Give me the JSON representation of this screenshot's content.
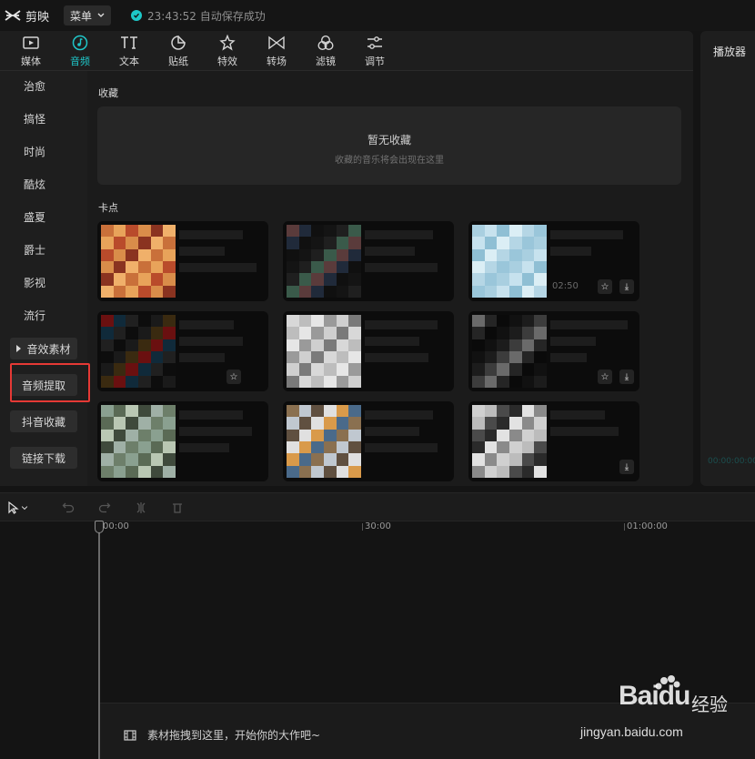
{
  "titlebar": {
    "app_name": "剪映",
    "menu_label": "菜单",
    "save_status": "23:43:52 自动保存成功"
  },
  "toolbar": {
    "tabs": [
      {
        "label": "媒体",
        "icon": "media-icon",
        "active": false
      },
      {
        "label": "音频",
        "icon": "audio-icon",
        "active": true
      },
      {
        "label": "文本",
        "icon": "text-icon",
        "active": false
      },
      {
        "label": "贴纸",
        "icon": "sticker-icon",
        "active": false
      },
      {
        "label": "特效",
        "icon": "effects-icon",
        "active": false
      },
      {
        "label": "转场",
        "icon": "transition-icon",
        "active": false
      },
      {
        "label": "滤镜",
        "icon": "filter-icon",
        "active": false
      },
      {
        "label": "调节",
        "icon": "adjust-icon",
        "active": false
      }
    ]
  },
  "sidebar": {
    "categories": [
      "治愈",
      "搞怪",
      "时尚",
      "酷炫",
      "盛夏",
      "爵士",
      "影视",
      "流行"
    ],
    "buttons": [
      "音效素材",
      "音频提取",
      "抖音收藏",
      "链接下载"
    ]
  },
  "content": {
    "favorites_title": "收藏",
    "favorites_empty": "暂无收藏",
    "favorites_hint": "收藏的音乐将会出现在这里",
    "section_kadian": "卡点",
    "duration_fragment": "02:50"
  },
  "player": {
    "title": "播放器",
    "time": "00:00:00:00"
  },
  "timeline": {
    "ticks": [
      "00:00",
      "30:00",
      "01:00:00"
    ],
    "drop_hint": "素材拖拽到这里，开始你的大作吧~"
  },
  "watermark": {
    "brand": "Baidu",
    "cn": "经验",
    "url": "jingyan.baidu.com"
  },
  "colors": {
    "accent": "#1fc6c8",
    "highlight": "#e53935"
  }
}
